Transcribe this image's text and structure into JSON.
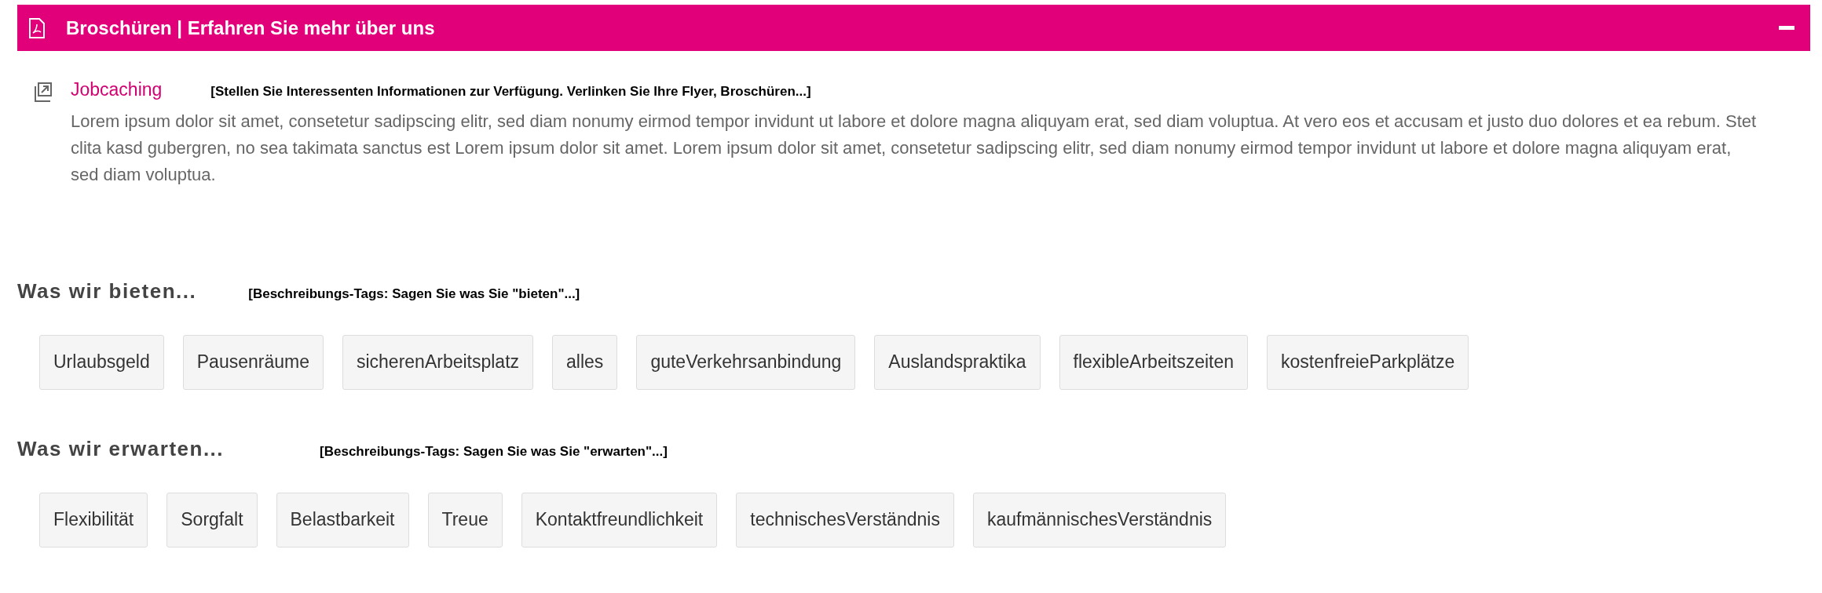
{
  "panel": {
    "title": "Broschüren | Erfahren Sie mehr über uns",
    "expanded": true
  },
  "item": {
    "link": "Jobcaching",
    "hint": "[Stellen Sie Interessenten Informationen zur Verfügung. Verlinken Sie Ihre Flyer, Broschüren...]",
    "description": "Lorem ipsum dolor sit amet, consetetur sadipscing elitr, sed diam nonumy eirmod tempor invidunt ut labore et dolore magna aliquyam erat, sed diam voluptua. At vero eos et accusam et justo duo dolores et ea rebum. Stet clita kasd gubergren, no sea takimata sanctus est Lorem ipsum dolor sit amet. Lorem ipsum dolor sit amet, consetetur sadipscing elitr, sed diam nonumy eirmod tempor invidunt ut labore et dolore magna aliquyam erat, sed diam voluptua."
  },
  "sections": [
    {
      "heading": "Was wir bieten...",
      "hint": "[Beschreibungs-Tags: Sagen Sie was Sie \"bieten\"...]",
      "tags": [
        "Urlaubsgeld",
        "Pausenräume",
        "sicherenArbeitsplatz",
        "alles",
        "guteVerkehrsanbindung",
        "Auslandspraktika",
        "flexibleArbeitszeiten",
        "kostenfreieParkplätze"
      ]
    },
    {
      "heading": "Was wir erwarten...",
      "hint": "[Beschreibungs-Tags: Sagen Sie was Sie \"erwarten\"...]",
      "tags": [
        "Flexibilität",
        "Sorgfalt",
        "Belastbarkeit",
        "Treue",
        "Kontaktfreundlichkeit",
        "technischesVerständnis",
        "kaufmännischesVerständnis"
      ]
    }
  ]
}
